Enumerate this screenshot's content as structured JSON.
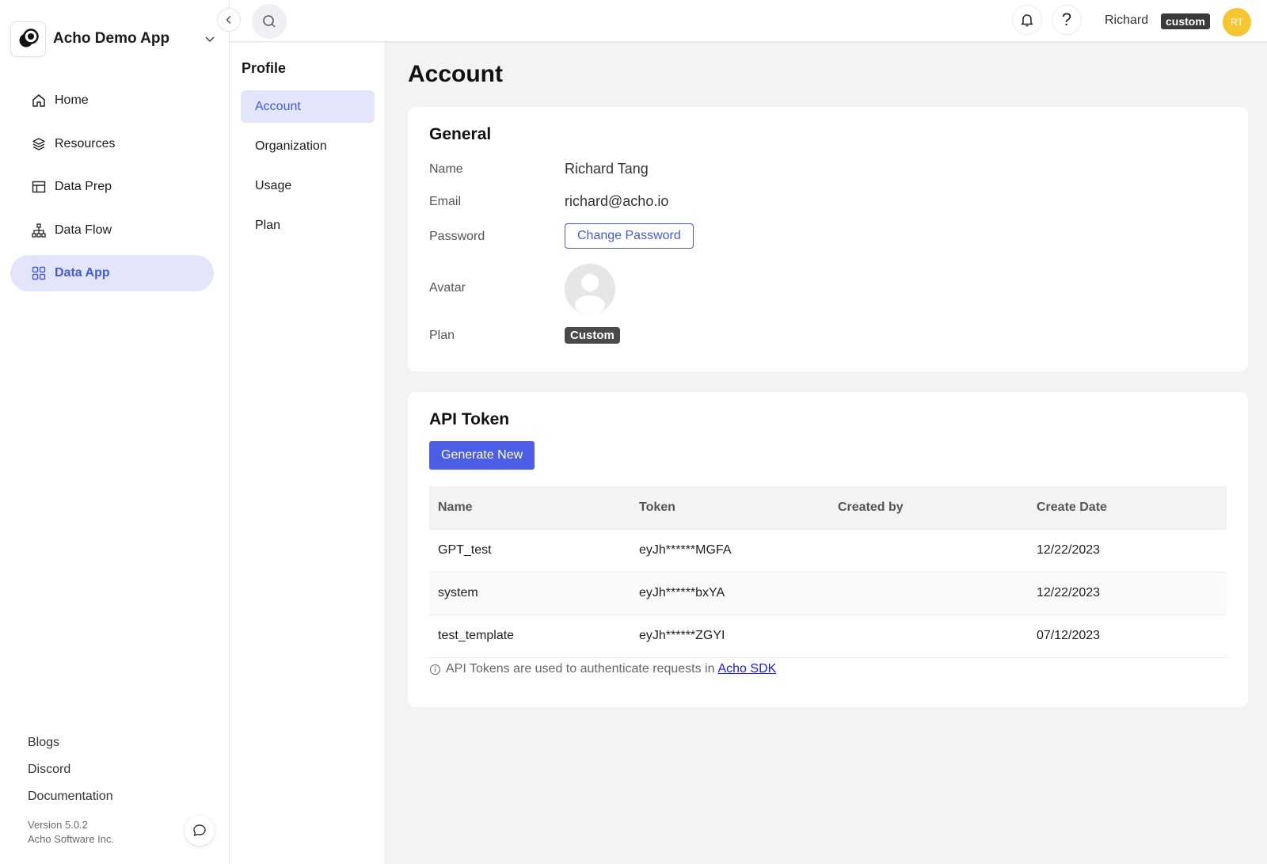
{
  "app": {
    "name": "Acho Demo App"
  },
  "sidebar": {
    "items": [
      {
        "label": "Home",
        "icon": "home-icon"
      },
      {
        "label": "Resources",
        "icon": "layers-icon"
      },
      {
        "label": "Data Prep",
        "icon": "table-icon"
      },
      {
        "label": "Data Flow",
        "icon": "flow-icon"
      },
      {
        "label": "Data App",
        "icon": "grid-icon",
        "active": true
      }
    ],
    "links": [
      "Blogs",
      "Discord",
      "Documentation"
    ],
    "version": "Version 5.0.2",
    "company": "Acho Software Inc."
  },
  "topbar": {
    "user_name": "Richard",
    "plan_chip": "custom",
    "avatar_initials": "RT"
  },
  "profile_nav": {
    "title": "Profile",
    "items": [
      "Account",
      "Organization",
      "Usage",
      "Plan"
    ],
    "active": "Account"
  },
  "page": {
    "title": "Account"
  },
  "general": {
    "title": "General",
    "labels": {
      "name": "Name",
      "email": "Email",
      "password": "Password",
      "avatar": "Avatar",
      "plan": "Plan"
    },
    "name": "Richard Tang",
    "email": "richard@acho.io",
    "change_password_label": "Change Password",
    "plan": "Custom"
  },
  "api_token": {
    "title": "API Token",
    "generate_label": "Generate New",
    "columns": [
      "Name",
      "Token",
      "Created by",
      "Create Date"
    ],
    "rows": [
      {
        "name": "GPT_test",
        "token": "eyJh******MGFA",
        "created_by": "",
        "date": "12/22/2023"
      },
      {
        "name": "system",
        "token": "eyJh******bxYA",
        "created_by": "",
        "date": "12/22/2023"
      },
      {
        "name": "test_template",
        "token": "eyJh******ZGYI",
        "created_by": "",
        "date": "07/12/2023"
      }
    ],
    "note": "API Tokens are used to authenticate requests in",
    "note_link": "Acho SDK"
  },
  "colors": {
    "accent": "#4659d6",
    "primary_button": "#4c5ee6",
    "active_bg": "#e3e6fb",
    "avatar_bg": "#f7c531"
  }
}
